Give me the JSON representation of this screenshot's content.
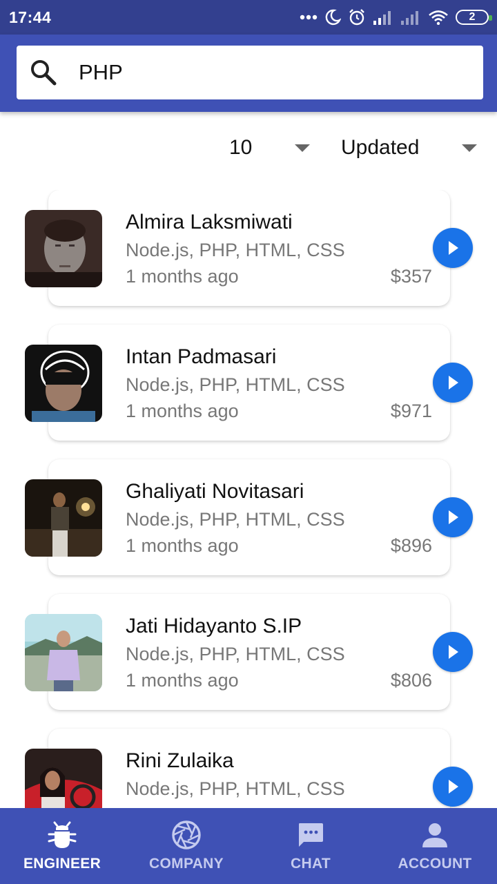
{
  "status_bar": {
    "time": "17:44",
    "battery_level": "2"
  },
  "search": {
    "value": "PHP",
    "placeholder": ""
  },
  "filters": {
    "limit_value": "10",
    "sort_value": "Updated"
  },
  "engineers": [
    {
      "name": "Almira Laksmiwati",
      "skills": "Node.js, PHP, HTML, CSS",
      "updated": "1 months ago",
      "price": "$357"
    },
    {
      "name": "Intan Padmasari",
      "skills": "Node.js, PHP, HTML, CSS",
      "updated": "1 months ago",
      "price": "$971"
    },
    {
      "name": "Ghaliyati Novitasari",
      "skills": "Node.js, PHP, HTML, CSS",
      "updated": "1 months ago",
      "price": "$896"
    },
    {
      "name": "Jati Hidayanto S.IP",
      "skills": "Node.js, PHP, HTML, CSS",
      "updated": "1 months ago",
      "price": "$806"
    },
    {
      "name": "Rini Zulaika",
      "skills": "Node.js, PHP, HTML, CSS",
      "updated": "",
      "price": ""
    }
  ],
  "bottom_nav": [
    {
      "label": "ENGINEER",
      "icon": "bug-icon",
      "active": true
    },
    {
      "label": "COMPANY",
      "icon": "aperture-icon",
      "active": false
    },
    {
      "label": "CHAT",
      "icon": "chat-icon",
      "active": false
    },
    {
      "label": "ACCOUNT",
      "icon": "account-icon",
      "active": false
    }
  ],
  "colors": {
    "primary": "#3f51b5",
    "status_bar": "#33408f",
    "accent_button": "#1a73e8"
  }
}
